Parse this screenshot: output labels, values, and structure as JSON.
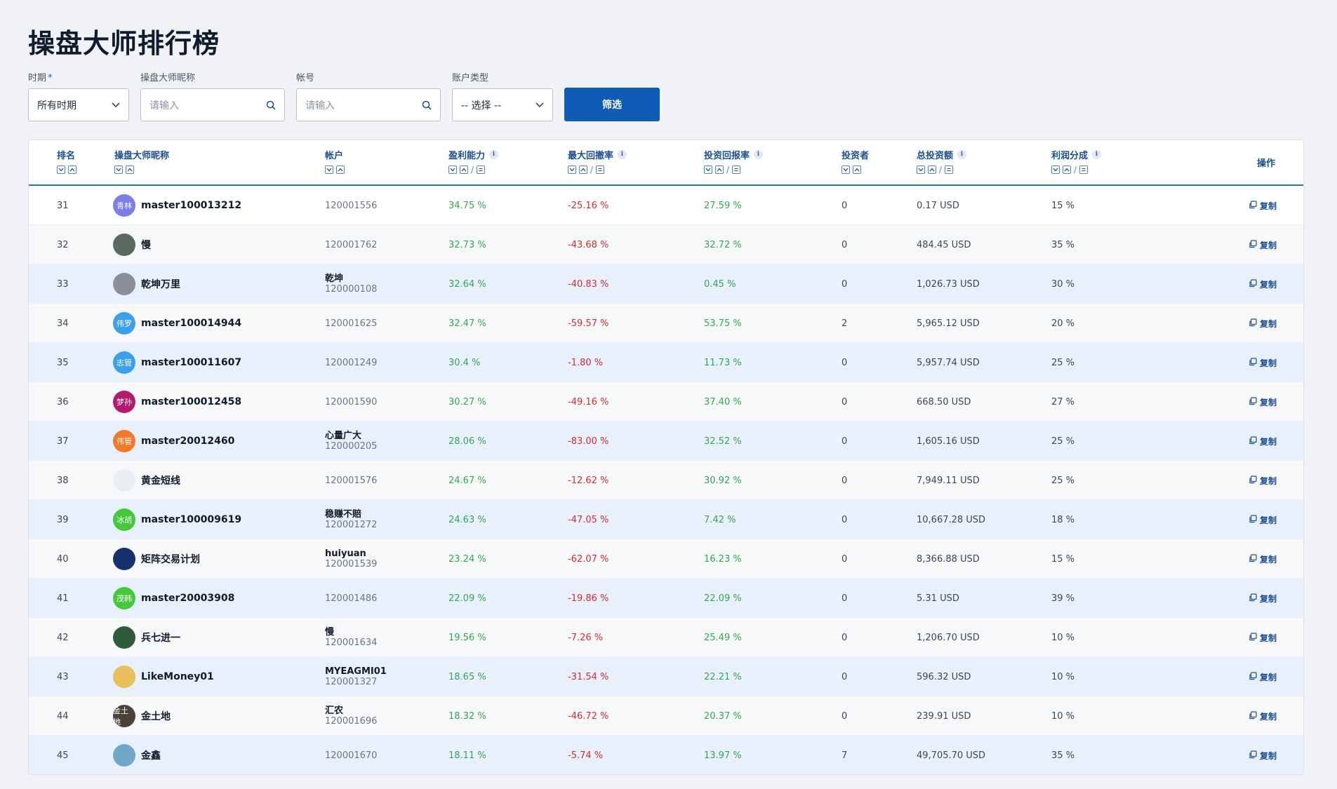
{
  "page_title": "操盘大师排行榜",
  "filters": {
    "period_label": "时期",
    "period_required": "*",
    "period_value": "所有时期",
    "nickname_label": "操盘大师昵称",
    "nickname_placeholder": "请输入",
    "account_label": "帐号",
    "account_placeholder": "请输入",
    "type_label": "账户类型",
    "type_value": "-- 选择 --",
    "submit_label": "筛选"
  },
  "columns": {
    "rank": "排名",
    "nickname": "操盘大师昵称",
    "account": "帐户",
    "profit": "盈利能力",
    "drawdown": "最大回撤率",
    "roi": "投资回报率",
    "investors": "投资者",
    "total": "总投资额",
    "share": "利润分成",
    "action": "操作",
    "info_glyph": "i",
    "slash": "/"
  },
  "colors": {
    "primary": "#0d5bb5",
    "header_text": "#1a4f8f",
    "positive": "#2fa84f",
    "negative": "#d52b2b"
  },
  "rows": [
    {
      "rank": "31",
      "name": "master100013212",
      "avatar_text": "青林",
      "avatar_color": "#7b7de8",
      "acct_title": "",
      "acct": "120001556",
      "profit": "34.75 %",
      "drawdown": "-25.16 %",
      "roi": "27.59 %",
      "investors": "0",
      "total": "0.17 USD",
      "share": "15 %",
      "action": "复制"
    },
    {
      "rank": "32",
      "name": "慢",
      "avatar_text": "",
      "avatar_color": "#5a6a5e",
      "acct_title": "",
      "acct": "120001762",
      "profit": "32.73 %",
      "drawdown": "-43.68 %",
      "roi": "32.72 %",
      "investors": "0",
      "total": "484.45 USD",
      "share": "35 %",
      "action": "复制"
    },
    {
      "rank": "33",
      "name": "乾坤万里",
      "avatar_text": "",
      "avatar_color": "#8a8f99",
      "acct_title": "乾坤",
      "acct": "120000108",
      "profit": "32.64 %",
      "drawdown": "-40.83 %",
      "roi": "0.45 %",
      "investors": "0",
      "total": "1,026.73 USD",
      "share": "30 %",
      "action": "复制"
    },
    {
      "rank": "34",
      "name": "master100014944",
      "avatar_text": "伟罗",
      "avatar_color": "#3aa0ea",
      "acct_title": "",
      "acct": "120001625",
      "profit": "32.47 %",
      "drawdown": "-59.57 %",
      "roi": "53.75 %",
      "investors": "2",
      "total": "5,965.12 USD",
      "share": "20 %",
      "action": "复制"
    },
    {
      "rank": "35",
      "name": "master100011607",
      "avatar_text": "志管",
      "avatar_color": "#3aa0ea",
      "acct_title": "",
      "acct": "120001249",
      "profit": "30.4 %",
      "drawdown": "-1.80 %",
      "roi": "11.73 %",
      "investors": "0",
      "total": "5,957.74 USD",
      "share": "25 %",
      "action": "复制"
    },
    {
      "rank": "36",
      "name": "master100012458",
      "avatar_text": "梦孙",
      "avatar_color": "#b5196e",
      "acct_title": "",
      "acct": "120001590",
      "profit": "30.27 %",
      "drawdown": "-49.16 %",
      "roi": "37.40 %",
      "investors": "0",
      "total": "668.50 USD",
      "share": "27 %",
      "action": "复制"
    },
    {
      "rank": "37",
      "name": "master20012460",
      "avatar_text": "伟管",
      "avatar_color": "#f07a2a",
      "acct_title": "心量广大",
      "acct": "120000205",
      "profit": "28.06 %",
      "drawdown": "-83.00 %",
      "roi": "32.52 %",
      "investors": "0",
      "total": "1,605.16 USD",
      "share": "25 %",
      "action": "复制"
    },
    {
      "rank": "38",
      "name": "黄金短线",
      "avatar_text": "",
      "avatar_color": "#e9eef5",
      "acct_title": "",
      "acct": "120001576",
      "profit": "24.67 %",
      "drawdown": "-12.62 %",
      "roi": "30.92 %",
      "investors": "0",
      "total": "7,949.11 USD",
      "share": "25 %",
      "action": "复制"
    },
    {
      "rank": "39",
      "name": "master100009619",
      "avatar_text": "冰胡",
      "avatar_color": "#44c93a",
      "acct_title": "稳赚不赔",
      "acct": "120001272",
      "profit": "24.63 %",
      "drawdown": "-47.05 %",
      "roi": "7.42 %",
      "investors": "0",
      "total": "10,667.28 USD",
      "share": "18 %",
      "action": "复制"
    },
    {
      "rank": "40",
      "name": "矩阵交易计划",
      "avatar_text": "",
      "avatar_color": "#17306e",
      "acct_title": "huiyuan",
      "acct": "120001539",
      "profit": "23.24 %",
      "drawdown": "-62.07 %",
      "roi": "16.23 %",
      "investors": "0",
      "total": "8,366.88 USD",
      "share": "15 %",
      "action": "复制"
    },
    {
      "rank": "41",
      "name": "master20003908",
      "avatar_text": "茂韩",
      "avatar_color": "#44c93a",
      "acct_title": "",
      "acct": "120001486",
      "profit": "22.09 %",
      "drawdown": "-19.86 %",
      "roi": "22.09 %",
      "investors": "0",
      "total": "5.31 USD",
      "share": "39 %",
      "action": "复制"
    },
    {
      "rank": "42",
      "name": "兵七进一",
      "avatar_text": "",
      "avatar_color": "#2e5c3a",
      "acct_title": "慢",
      "acct": "120001634",
      "profit": "19.56 %",
      "drawdown": "-7.26 %",
      "roi": "25.49 %",
      "investors": "0",
      "total": "1,206.70 USD",
      "share": "10 %",
      "action": "复制"
    },
    {
      "rank": "43",
      "name": "LikeMoney01",
      "avatar_text": "",
      "avatar_color": "#e8c15a",
      "acct_title": "MYEAGMI01",
      "acct": "120001327",
      "profit": "18.65 %",
      "drawdown": "-31.54 %",
      "roi": "22.21 %",
      "investors": "0",
      "total": "596.32 USD",
      "share": "10 %",
      "action": "复制"
    },
    {
      "rank": "44",
      "name": "金土地",
      "avatar_text": "金土地",
      "avatar_color": "#4a4236",
      "acct_title": "汇农",
      "acct": "120001696",
      "profit": "18.32 %",
      "drawdown": "-46.72 %",
      "roi": "20.37 %",
      "investors": "0",
      "total": "239.91 USD",
      "share": "10 %",
      "action": "复制"
    },
    {
      "rank": "45",
      "name": "金鑫",
      "avatar_text": "",
      "avatar_color": "#6fa8c9",
      "acct_title": "",
      "acct": "120001670",
      "profit": "18.11 %",
      "drawdown": "-5.74 %",
      "roi": "13.97 %",
      "investors": "7",
      "total": "49,705.70 USD",
      "share": "35 %",
      "action": "复制"
    }
  ]
}
